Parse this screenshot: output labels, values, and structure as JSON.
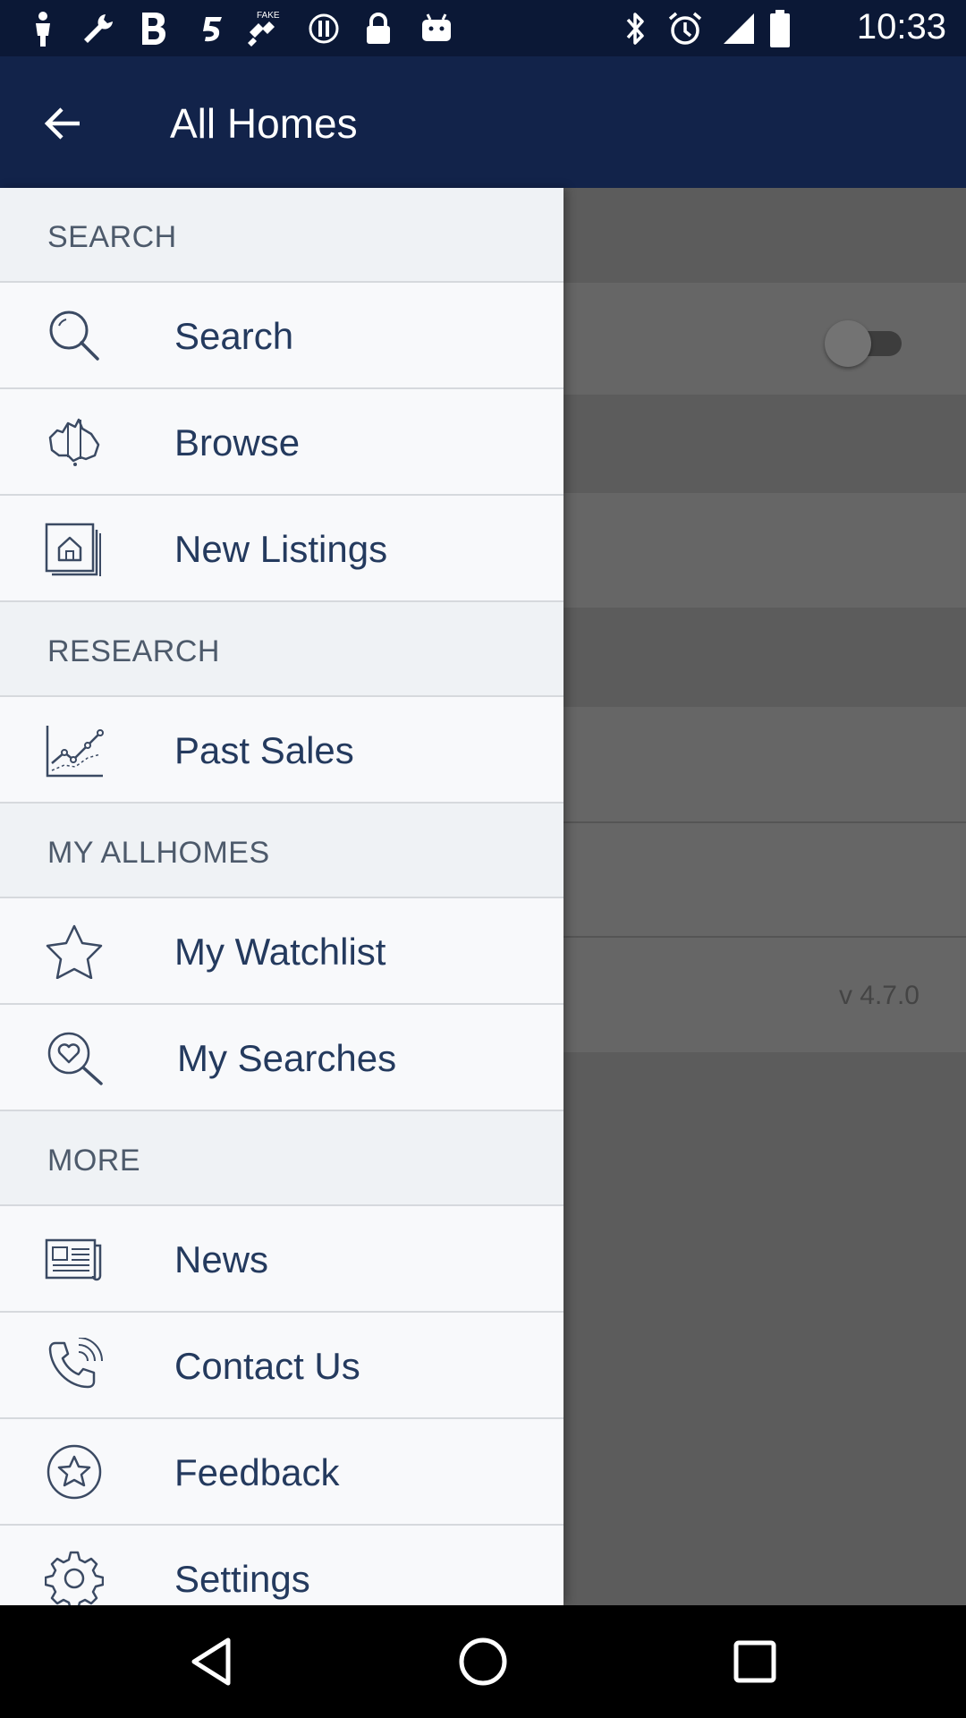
{
  "status_bar": {
    "time": "10:33",
    "left_icons": [
      "person-icon",
      "wrench-icon",
      "bold-b-icon",
      "sprint-5-icon",
      "fake-gps-icon",
      "alert-circle-icon",
      "lock-icon",
      "android-icon"
    ],
    "right_icons": [
      "bluetooth-icon",
      "alarm-icon",
      "signal-icon",
      "battery-icon"
    ]
  },
  "app_bar": {
    "title": "All Homes",
    "back_icon": "arrow-back-icon"
  },
  "background": {
    "version": "v 4.7.0"
  },
  "drawer": {
    "sections": [
      {
        "header": "SEARCH",
        "items": [
          {
            "label": "Search",
            "icon": "search-icon"
          },
          {
            "label": "Browse",
            "icon": "australia-map-icon"
          },
          {
            "label": "New Listings",
            "icon": "new-listings-icon"
          }
        ]
      },
      {
        "header": "RESEARCH",
        "items": [
          {
            "label": "Past Sales",
            "icon": "chart-icon"
          }
        ]
      },
      {
        "header": "MY ALLHOMES",
        "items": [
          {
            "label": "My Watchlist",
            "icon": "star-icon"
          },
          {
            "label": "My Searches",
            "icon": "heart-search-icon"
          }
        ]
      },
      {
        "header": "MORE",
        "items": [
          {
            "label": "News",
            "icon": "newspaper-icon"
          },
          {
            "label": "Contact Us",
            "icon": "phone-icon"
          },
          {
            "label": "Feedback",
            "icon": "feedback-star-icon"
          },
          {
            "label": "Settings",
            "icon": "gear-icon"
          }
        ]
      }
    ]
  },
  "nav_bar": {
    "buttons": [
      "back-triangle-icon",
      "home-circle-icon",
      "recents-square-icon"
    ]
  },
  "colors": {
    "app_bar": "#12234a",
    "status_bar": "#0b1836",
    "drawer_bg": "#f7f8fa",
    "section_bg": "#eff2f5",
    "item_text": "#243a5e",
    "icon_stroke": "#3b4a63",
    "scrim": "#5c5c5c"
  }
}
